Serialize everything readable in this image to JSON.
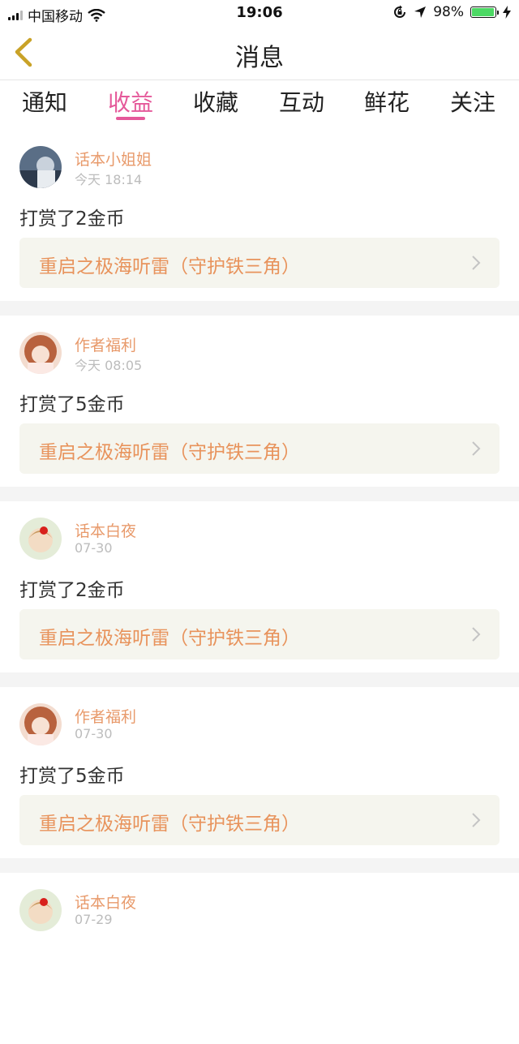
{
  "status_bar": {
    "carrier": "中国移动",
    "time": "19:06",
    "battery_percent": "98%",
    "battery_level": 0.98,
    "icons": [
      "signal-icon",
      "wifi-icon",
      "rotation-lock-icon",
      "location-icon",
      "battery-icon",
      "charging-icon"
    ]
  },
  "header": {
    "title": "消息",
    "back_icon": "chevron-left-icon"
  },
  "tabs": [
    {
      "label": "通知",
      "active": false
    },
    {
      "label": "收益",
      "active": true
    },
    {
      "label": "收藏",
      "active": false
    },
    {
      "label": "互动",
      "active": false
    },
    {
      "label": "鲜花",
      "active": false
    },
    {
      "label": "关注",
      "active": false
    }
  ],
  "messages": [
    {
      "sender": "话本小姐姐",
      "time": "今天 18:14",
      "text": "打赏了2金币",
      "link": "重启之极海听雷（守护铁三角）"
    },
    {
      "sender": "作者福利",
      "time": "今天 08:05",
      "text": "打赏了5金币",
      "link": "重启之极海听雷（守护铁三角）"
    },
    {
      "sender": "话本白夜",
      "time": "07-30",
      "text": "打赏了2金币",
      "link": "重启之极海听雷（守护铁三角）"
    },
    {
      "sender": "作者福利",
      "time": "07-30",
      "text": "打赏了5金币",
      "link": "重启之极海听雷（守护铁三角）"
    },
    {
      "sender": "话本白夜",
      "time": "07-29",
      "text": "",
      "link": ""
    }
  ],
  "colors": {
    "accent": "#e5599a",
    "sender": "#e89a6b",
    "link_text": "#e8935c",
    "link_bg": "#f5f5ee",
    "back_icon": "#c9a227"
  }
}
